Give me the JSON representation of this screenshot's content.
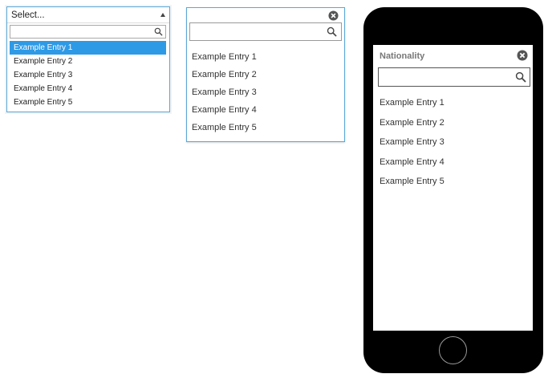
{
  "select_dropdown": {
    "placeholder": "Select...",
    "search_value": "",
    "entries": [
      "Example Entry 1",
      "Example Entry 2",
      "Example Entry 3",
      "Example Entry 4",
      "Example Entry 5"
    ],
    "active_index": 0,
    "highlight_color": "#2e9ae6"
  },
  "panel_dropdown": {
    "search_value": "",
    "entries": [
      "Example Entry 1",
      "Example Entry 2",
      "Example Entry 3",
      "Example Entry 4",
      "Example Entry 5"
    ]
  },
  "mobile_picker": {
    "title": "Nationality",
    "search_value": "",
    "entries": [
      "Example Entry 1",
      "Example Entry 2",
      "Example Entry 3",
      "Example Entry 4",
      "Example Entry 5"
    ]
  },
  "icons": {
    "search": "search-icon",
    "close": "close-circle-icon",
    "caret": "caret-up-icon"
  },
  "colors": {
    "accent_border": "#5aa7d8",
    "phone_body": "#000000"
  }
}
